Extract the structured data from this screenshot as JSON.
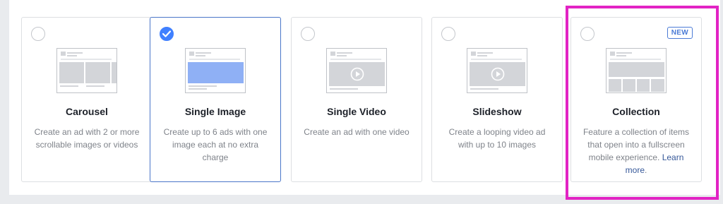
{
  "cards": [
    {
      "title": "Carousel",
      "description": "Create an ad with 2 or more scrollable images or videos",
      "selected": false
    },
    {
      "title": "Single Image",
      "description": "Create up to 6 ads with one image each at no extra charge",
      "selected": true
    },
    {
      "title": "Single Video",
      "description": "Create an ad with one video",
      "selected": false
    },
    {
      "title": "Slideshow",
      "description": "Create a looping video ad with up to 10 images",
      "selected": false
    },
    {
      "title": "Collection",
      "description": "Feature a collection of items that open into a fullscreen mobile experience.",
      "link_label": "Learn more",
      "link_suffix": ".",
      "badge": "NEW",
      "selected": false
    }
  ],
  "icons": {
    "carousel": "carousel-preview-icon",
    "single_image": "single-image-preview-icon",
    "single_video": "video-preview-icon",
    "slideshow": "slideshow-preview-icon",
    "collection": "collection-preview-icon",
    "check": "checkmark-icon"
  },
  "colors": {
    "accent": "#4080ff",
    "highlight_border": "#e223c4",
    "link": "#365899",
    "image_fill": "#8fb0f5"
  }
}
